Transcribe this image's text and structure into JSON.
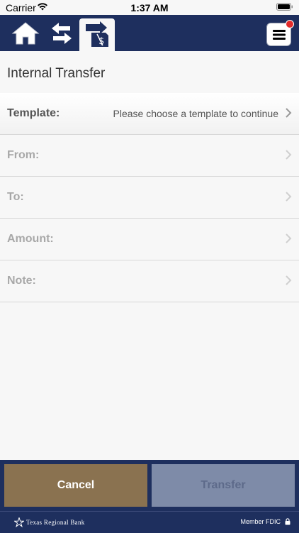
{
  "status_bar": {
    "carrier": "Carrier",
    "time": "1:37 AM"
  },
  "nav": {
    "home_icon": "home-icon",
    "transfer_icon": "transfer-arrows-icon",
    "active_icon": "internal-transfer-icon",
    "menu_icon": "hamburger-menu-icon",
    "notification_color": "#e32b2b"
  },
  "page": {
    "title": "Internal Transfer"
  },
  "form": {
    "template_label": "Template:",
    "template_value": "Please choose a template to continue",
    "from_label": "From:",
    "to_label": "To:",
    "amount_label": "Amount:",
    "note_label": "Note:"
  },
  "footer": {
    "cancel_label": "Cancel",
    "transfer_label": "Transfer",
    "cancel_color": "#8a7250",
    "transfer_color": "#7e8ba8"
  },
  "bottom": {
    "bank_name": "Texas Regional Bank",
    "fdic": "Member FDIC"
  },
  "colors": {
    "brand_navy": "#1e2f5e",
    "background": "#f7f7f7"
  }
}
